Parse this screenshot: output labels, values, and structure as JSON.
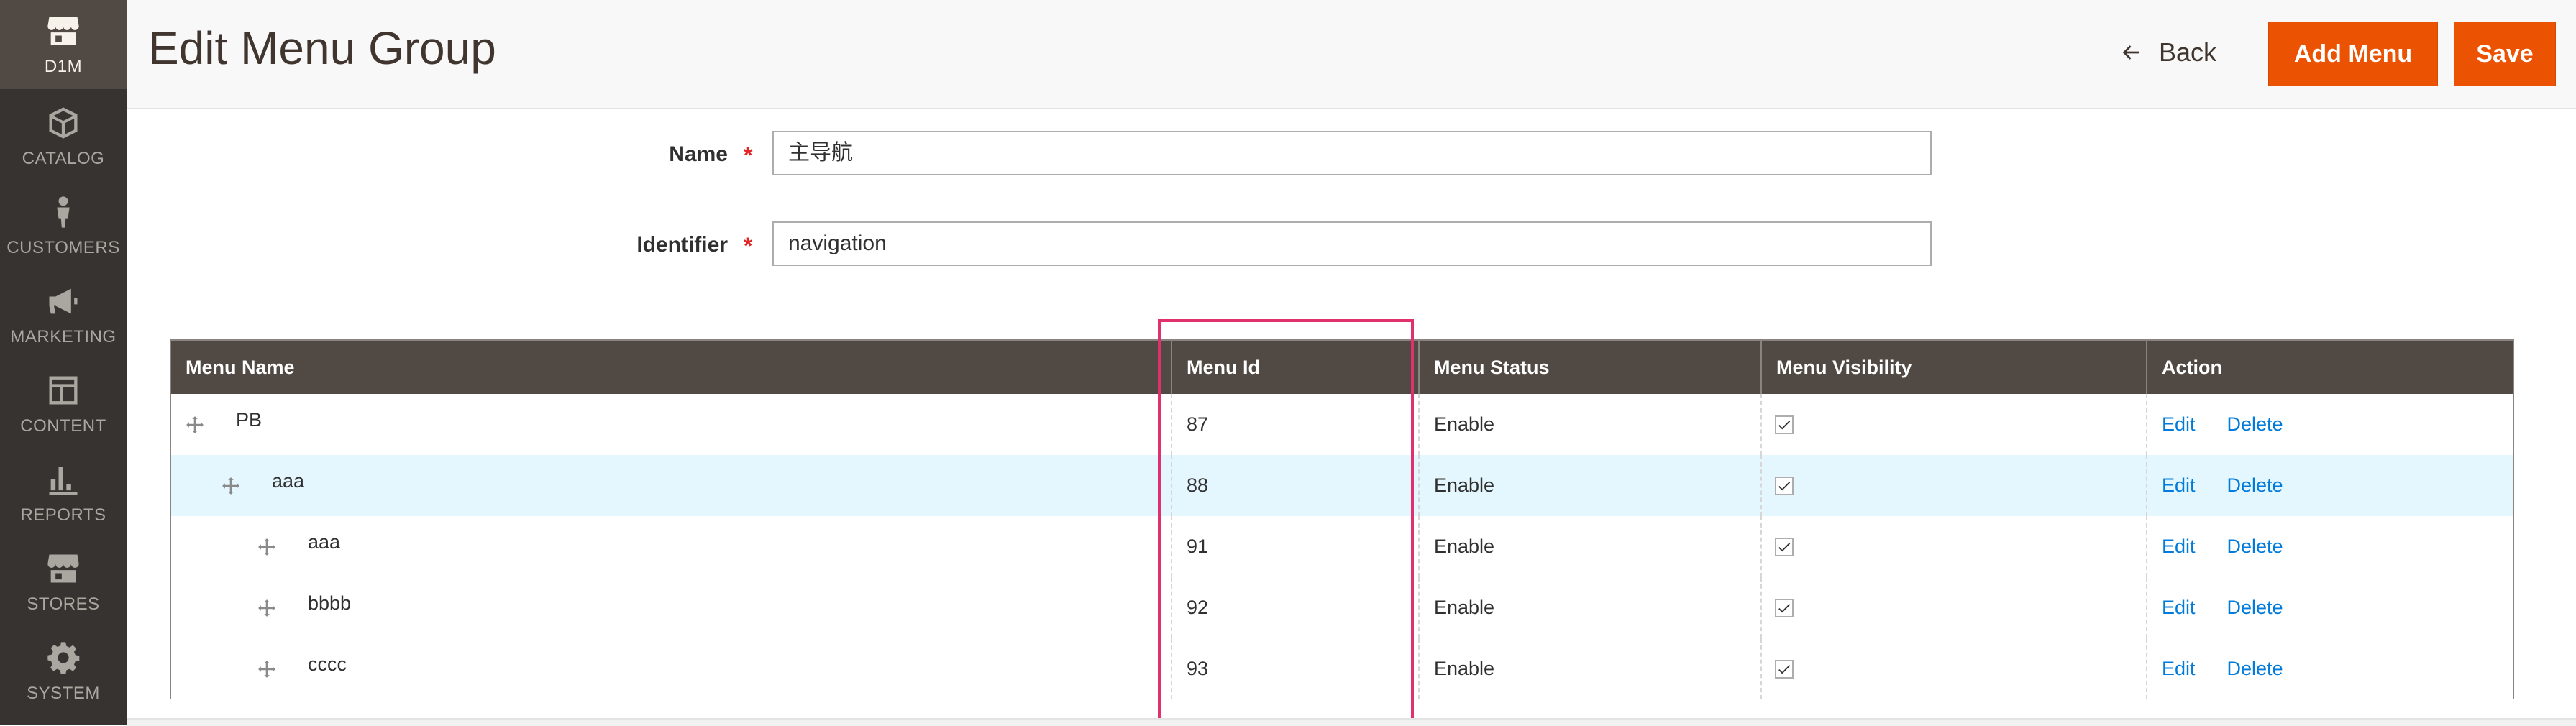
{
  "sidebar": {
    "items": [
      {
        "label": "D1M",
        "icon": "store-icon"
      },
      {
        "label": "CATALOG",
        "icon": "box-icon"
      },
      {
        "label": "CUSTOMERS",
        "icon": "person-icon"
      },
      {
        "label": "MARKETING",
        "icon": "megaphone-icon"
      },
      {
        "label": "CONTENT",
        "icon": "layout-icon"
      },
      {
        "label": "REPORTS",
        "icon": "bar-chart-icon"
      },
      {
        "label": "STORES",
        "icon": "store-icon"
      },
      {
        "label": "SYSTEM",
        "icon": "gear-icon"
      }
    ]
  },
  "header": {
    "title": "Edit Menu Group",
    "back_label": "Back",
    "add_menu_label": "Add Menu",
    "save_label": "Save"
  },
  "form": {
    "name_label": "Name",
    "name_value": "主导航",
    "identifier_label": "Identifier",
    "identifier_value": "navigation",
    "required_mark": "*"
  },
  "grid": {
    "columns": [
      "Menu Name",
      "Menu Id",
      "Menu Status",
      "Menu Visibility",
      "Action"
    ],
    "rows": [
      {
        "name": "PB",
        "level": 0,
        "id": "87",
        "status": "Enable",
        "visible": true,
        "highlighted": false
      },
      {
        "name": "aaa",
        "level": 1,
        "id": "88",
        "status": "Enable",
        "visible": true,
        "highlighted": true
      },
      {
        "name": "aaa",
        "level": 2,
        "id": "91",
        "status": "Enable",
        "visible": true,
        "highlighted": false
      },
      {
        "name": "bbbb",
        "level": 2,
        "id": "92",
        "status": "Enable",
        "visible": true,
        "highlighted": false
      },
      {
        "name": "cccc",
        "level": 2,
        "id": "93",
        "status": "Enable",
        "visible": true,
        "highlighted": false
      }
    ],
    "edit_label": "Edit",
    "delete_label": "Delete"
  },
  "colors": {
    "accent": "#eb5202",
    "sidebar": "#373330",
    "grid_header": "#514943",
    "link": "#007bdb",
    "highlight_box": "#e0306e",
    "row_highlight": "#e5f7fe"
  }
}
